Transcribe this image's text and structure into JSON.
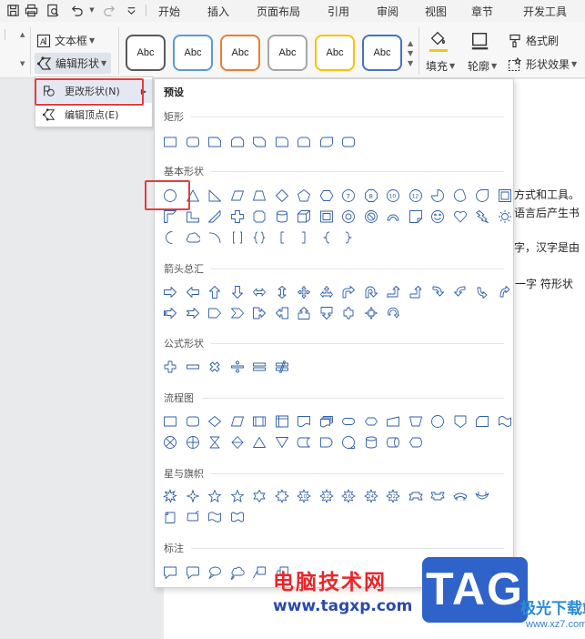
{
  "menubar": {
    "tabs": [
      "开始",
      "插入",
      "页面布局",
      "引用",
      "审阅",
      "视图",
      "章节",
      "开发工具"
    ]
  },
  "ribbon": {
    "textbox_label": "文本框",
    "edit_shape_label": "编辑形状",
    "style_samples": [
      "Abc",
      "Abc",
      "Abc",
      "Abc",
      "Abc",
      "Abc"
    ],
    "style_colors": [
      "#5a5a5a",
      "#5b9bd5",
      "#ed7d31",
      "#a5a5a5",
      "#ffc000",
      "#4472c4"
    ],
    "fill_label": "填充",
    "outline_label": "轮廓",
    "format_painter_label": "格式刷",
    "shape_effects_label": "形状效果"
  },
  "edit_menu": {
    "change_shape": "更改形状(N)",
    "edit_points": "编辑顶点(E)"
  },
  "gallery": {
    "title": "预设",
    "categories": {
      "rect": "矩形",
      "basic": "基本形状",
      "arrows": "箭头总汇",
      "formula": "公式形状",
      "flowchart": "流程图",
      "stars": "星与旗帜",
      "callouts": "标注"
    }
  },
  "document": {
    "lines": [
      "方式和工具。",
      "语言后产生书",
      "字，汉字是由",
      "一字  符形状"
    ]
  },
  "watermark": {
    "site_name": "电脑技术网",
    "site_url": "www.tagxp.com",
    "logo_text": "TAG",
    "download_site": "极光下载站",
    "download_url": "www.xz7.com"
  },
  "colors": {
    "highlight_red": "#e43d3d",
    "icon_blue": "#2f5fa8",
    "tag_blue": "#2f63c9"
  }
}
